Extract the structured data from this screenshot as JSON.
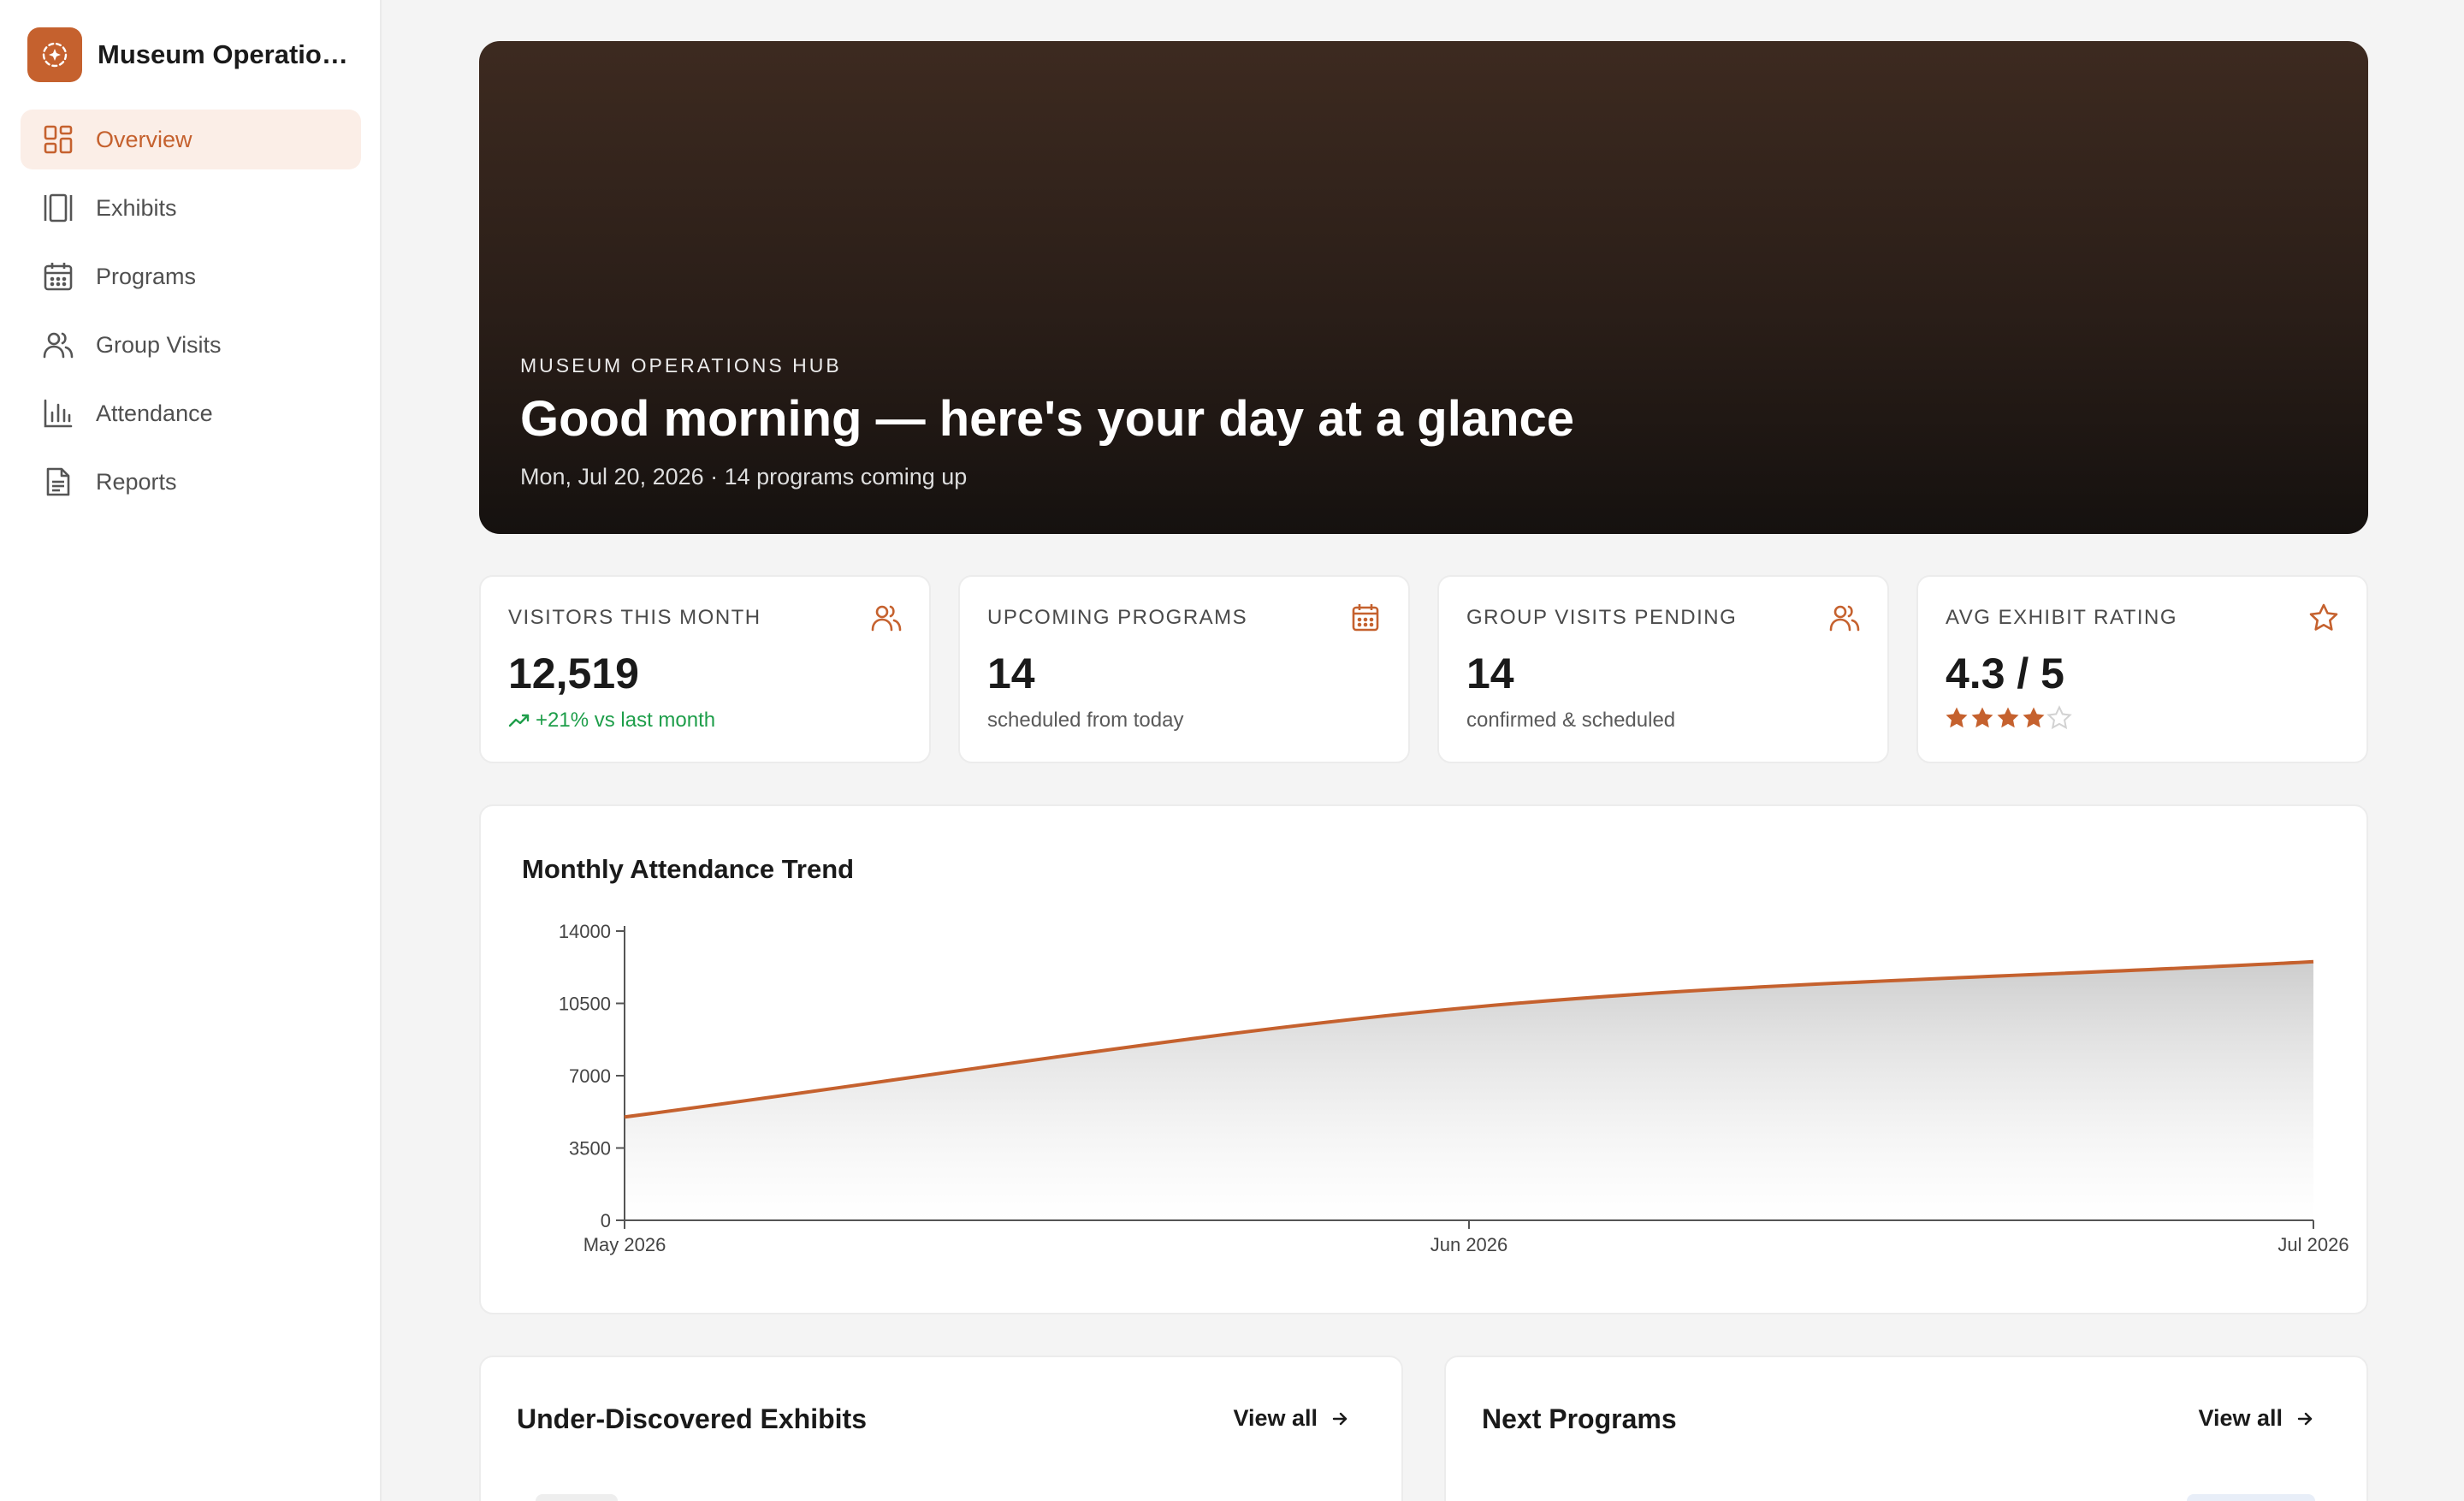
{
  "app": {
    "name": "Museum Operations Hub"
  },
  "sidebar": {
    "items": [
      {
        "label": "Overview",
        "icon": "dashboard-icon",
        "active": true
      },
      {
        "label": "Exhibits",
        "icon": "gallery-icon"
      },
      {
        "label": "Programs",
        "icon": "calendar-icon"
      },
      {
        "label": "Group Visits",
        "icon": "users-icon"
      },
      {
        "label": "Attendance",
        "icon": "bar-chart-icon"
      },
      {
        "label": "Reports",
        "icon": "document-icon"
      }
    ]
  },
  "hero": {
    "eyebrow": "MUSEUM OPERATIONS HUB",
    "title": "Good morning — here's your day at a glance",
    "subtitle": "Mon, Jul 20, 2026 · 14 programs coming up"
  },
  "stats": [
    {
      "label": "VISITORS THIS MONTH",
      "value": "12,519",
      "note": "+21% vs last month",
      "icon": "users-icon"
    },
    {
      "label": "UPCOMING PROGRAMS",
      "value": "14",
      "note": "scheduled from today",
      "icon": "calendar-icon"
    },
    {
      "label": "GROUP VISITS PENDING",
      "value": "14",
      "note": "confirmed & scheduled",
      "icon": "users-icon"
    },
    {
      "label": "AVG EXHIBIT RATING",
      "value": "4.3 / 5",
      "rating": 4,
      "rating_max": 5,
      "icon": "star-icon"
    }
  ],
  "chart_data": {
    "type": "area",
    "title": "Monthly Attendance Trend",
    "x": [
      "May 2026",
      "Jun 2026",
      "Jul 2026"
    ],
    "series": [
      {
        "values": [
          5000,
          10300,
          12519
        ]
      }
    ],
    "yticks": [
      0,
      3500,
      7000,
      10500,
      14000
    ],
    "ylim": [
      0,
      14000
    ],
    "color": "#c5612e"
  },
  "lists": [
    {
      "title": "Under-Discovered Exhibits",
      "action": "View all"
    },
    {
      "title": "Next Programs",
      "action": "View all"
    }
  ],
  "colors": {
    "accent": "#c5612e",
    "positive": "#1e9e4a"
  }
}
